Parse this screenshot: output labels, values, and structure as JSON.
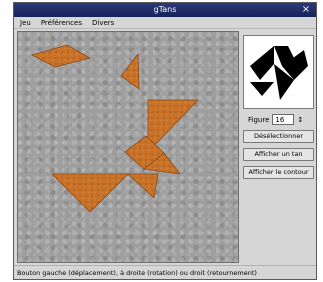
{
  "window": {
    "title": "gTans",
    "close_glyph": "×"
  },
  "menu": [
    "Jeu",
    "Préférences",
    "Divers"
  ],
  "controls": {
    "figure_label": "Figure",
    "figure_value": "16",
    "spin_glyph": "↕",
    "buttons": [
      "Désélectionner",
      "Afficher un tan",
      "Afficher le contour"
    ]
  },
  "status": "Bouton gauche (déplacement), à droite (rotation) ou droit (retournement)",
  "colors": {
    "piece": "#c8722a",
    "piece_edge": "#8a4a15",
    "title_bar": "#1e2d6a",
    "board": "#9e9e9e",
    "silhouette": "#000000"
  },
  "icons": {
    "close": "close-icon",
    "spin": "spinner-icon"
  }
}
